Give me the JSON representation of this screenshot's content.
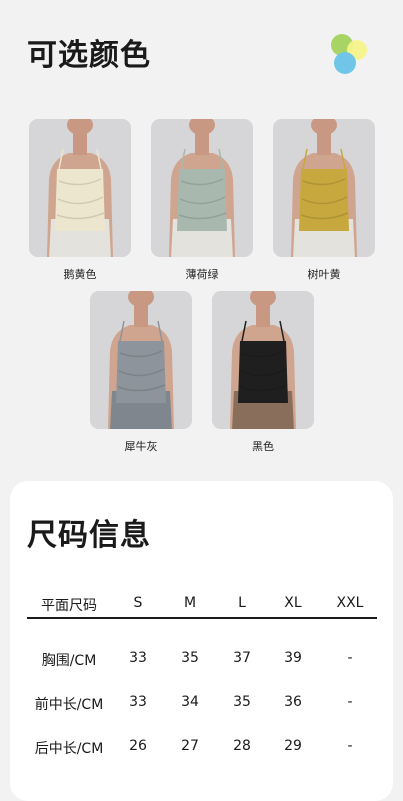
{
  "colors_section": {
    "title": "可选颜色",
    "swatches": [
      {
        "name": "鹅黄色",
        "color": "#ede6cf"
      },
      {
        "name": "薄荷绿",
        "color": "#a9b8ae"
      },
      {
        "name": "树叶黄",
        "color": "#c6a83e"
      },
      {
        "name": "犀牛灰",
        "color": "#8d949b"
      },
      {
        "name": "黑色",
        "color": "#1f1f1f"
      }
    ]
  },
  "size_section": {
    "title": "尺码信息",
    "headers": [
      "平面尺码",
      "S",
      "M",
      "L",
      "XL",
      "XXL"
    ],
    "rows": [
      [
        "胸围/CM",
        "33",
        "35",
        "37",
        "39",
        "-"
      ],
      [
        "前中长/CM",
        "33",
        "34",
        "35",
        "36",
        "-"
      ],
      [
        "后中长/CM",
        "26",
        "27",
        "28",
        "29",
        "-"
      ]
    ]
  }
}
